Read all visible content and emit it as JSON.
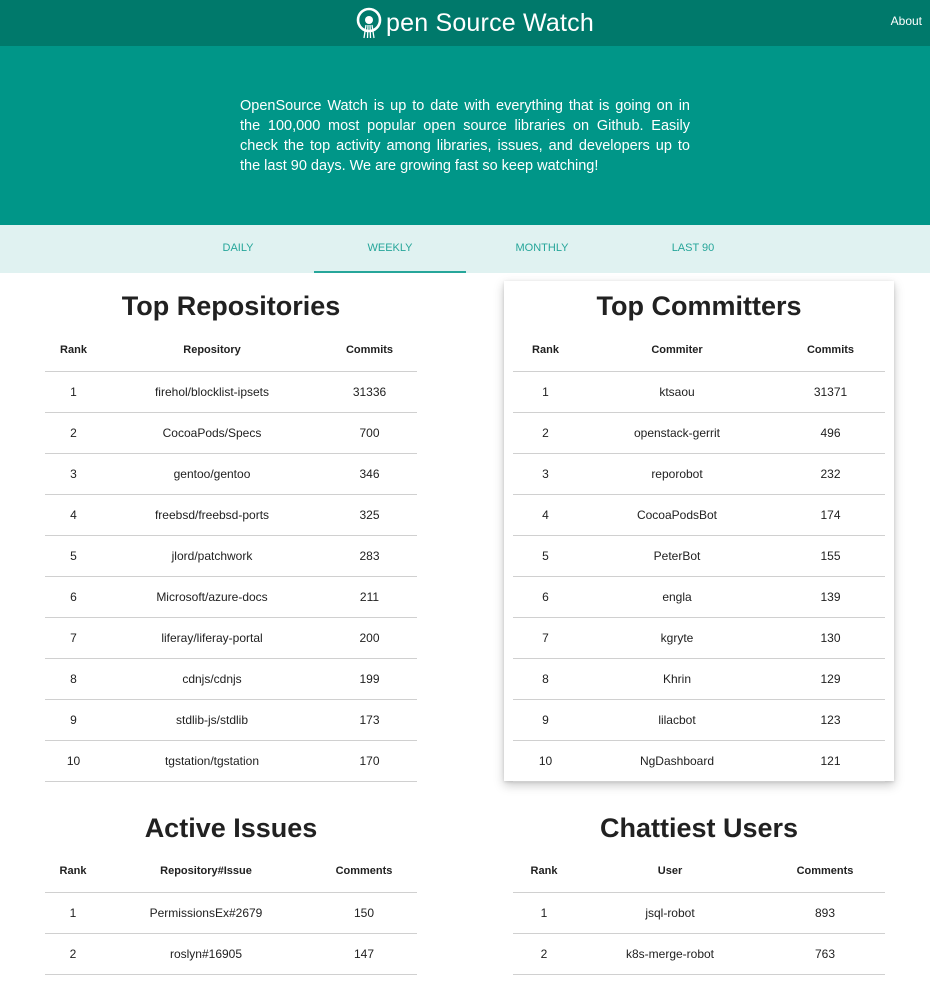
{
  "header": {
    "brand_text": "pen Source Watch",
    "about_label": "About",
    "bg_color": "#00796b"
  },
  "hero": {
    "text": "OpenSource Watch is up to date with everything that is going on in the 100,000 most popular open source libraries on Github. Easily check the top activity among libraries, issues, and developers up to the last 90 days. We are growing fast so keep watching!",
    "bg_color": "#009688"
  },
  "tabs": [
    {
      "label": "DAILY",
      "active": false
    },
    {
      "label": "WEEKLY",
      "active": true
    },
    {
      "label": "MONTHLY",
      "active": false
    },
    {
      "label": "LAST 90",
      "active": false
    }
  ],
  "top_repositories": {
    "title": "Top Repositories",
    "columns": [
      "Rank",
      "Repository",
      "Commits"
    ],
    "rows": [
      [
        "1",
        "firehol/blocklist-ipsets",
        "31336"
      ],
      [
        "2",
        "CocoaPods/Specs",
        "700"
      ],
      [
        "3",
        "gentoo/gentoo",
        "346"
      ],
      [
        "4",
        "freebsd/freebsd-ports",
        "325"
      ],
      [
        "5",
        "jlord/patchwork",
        "283"
      ],
      [
        "6",
        "Microsoft/azure-docs",
        "211"
      ],
      [
        "7",
        "liferay/liferay-portal",
        "200"
      ],
      [
        "8",
        "cdnjs/cdnjs",
        "199"
      ],
      [
        "9",
        "stdlib-js/stdlib",
        "173"
      ],
      [
        "10",
        "tgstation/tgstation",
        "170"
      ]
    ]
  },
  "top_committers": {
    "title": "Top Committers",
    "columns": [
      "Rank",
      "Commiter",
      "Commits"
    ],
    "rows": [
      [
        "1",
        "ktsaou",
        "31371"
      ],
      [
        "2",
        "openstack-gerrit",
        "496"
      ],
      [
        "3",
        "reporobot",
        "232"
      ],
      [
        "4",
        "CocoaPodsBot",
        "174"
      ],
      [
        "5",
        "PeterBot",
        "155"
      ],
      [
        "6",
        "engla",
        "139"
      ],
      [
        "7",
        "kgryte",
        "130"
      ],
      [
        "8",
        "Khrin",
        "129"
      ],
      [
        "9",
        "lilacbot",
        "123"
      ],
      [
        "10",
        "NgDashboard",
        "121"
      ]
    ]
  },
  "active_issues": {
    "title": "Active Issues",
    "columns": [
      "Rank",
      "Repository#Issue",
      "Comments"
    ],
    "rows": [
      [
        "1",
        "PermissionsEx#2679",
        "150"
      ],
      [
        "2",
        "roslyn#16905",
        "147"
      ]
    ]
  },
  "chattiest_users": {
    "title": "Chattiest Users",
    "columns": [
      "Rank",
      "User",
      "Comments"
    ],
    "rows": [
      [
        "1",
        "jsql-robot",
        "893"
      ],
      [
        "2",
        "k8s-merge-robot",
        "763"
      ]
    ]
  }
}
